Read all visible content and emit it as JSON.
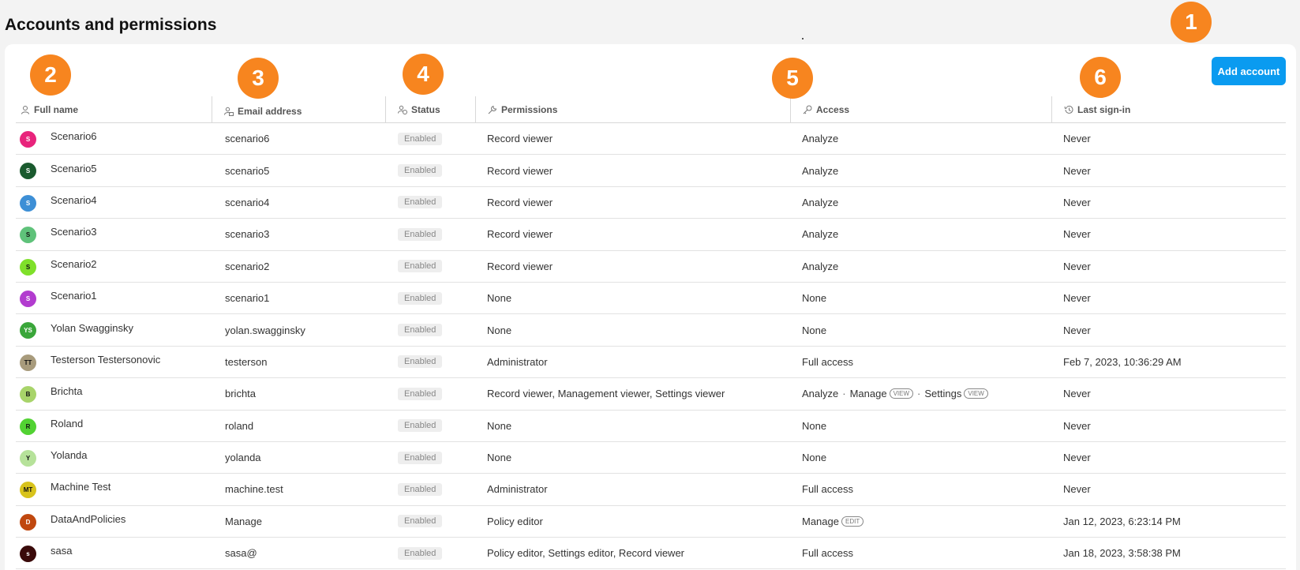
{
  "page": {
    "title": "Accounts and permissions"
  },
  "toolbar": {
    "add_label": "Add account"
  },
  "markers": [
    "1",
    "2",
    "3",
    "4",
    "5",
    "6"
  ],
  "columns": {
    "name": {
      "label": "Full name",
      "icon": "user-icon"
    },
    "email": {
      "label": "Email address",
      "icon": "user-email-icon"
    },
    "status": {
      "label": "Status",
      "icon": "user-status-icon"
    },
    "permissions": {
      "label": "Permissions",
      "icon": "wrench-icon"
    },
    "access": {
      "label": "Access",
      "icon": "key-icon"
    },
    "last": {
      "label": "Last sign-in",
      "icon": "history-icon"
    }
  },
  "colors": {
    "accent": "#0a9bf0",
    "marker": "#f7851f"
  },
  "rows": [
    {
      "initials": "S",
      "avatar_color": "#e8247c",
      "avatar_text": "#ffffff",
      "name": "Scenario6",
      "email": "scenario6",
      "status": "Enabled",
      "permissions": "Record viewer",
      "access": [
        {
          "t": "Analyze"
        }
      ],
      "last": "Never"
    },
    {
      "initials": "S",
      "avatar_color": "#1a5a2e",
      "avatar_text": "#ffffff",
      "name": "Scenario5",
      "email": "scenario5",
      "status": "Enabled",
      "permissions": "Record viewer",
      "access": [
        {
          "t": "Analyze"
        }
      ],
      "last": "Never"
    },
    {
      "initials": "S",
      "avatar_color": "#3d8fd6",
      "avatar_text": "#ffffff",
      "name": "Scenario4",
      "email": "scenario4",
      "status": "Enabled",
      "permissions": "Record viewer",
      "access": [
        {
          "t": "Analyze"
        }
      ],
      "last": "Never"
    },
    {
      "initials": "S",
      "avatar_color": "#5fc27a",
      "avatar_text": "#111111",
      "name": "Scenario3",
      "email": "scenario3",
      "status": "Enabled",
      "permissions": "Record viewer",
      "access": [
        {
          "t": "Analyze"
        }
      ],
      "last": "Never"
    },
    {
      "initials": "S",
      "avatar_color": "#7fe02a",
      "avatar_text": "#111111",
      "name": "Scenario2",
      "email": "scenario2",
      "status": "Enabled",
      "permissions": "Record viewer",
      "access": [
        {
          "t": "Analyze"
        }
      ],
      "last": "Never"
    },
    {
      "initials": "S",
      "avatar_color": "#b23ccf",
      "avatar_text": "#ffffff",
      "name": "Scenario1",
      "email": "scenario1",
      "status": "Enabled",
      "permissions": "None",
      "access": [
        {
          "t": "None"
        }
      ],
      "last": "Never"
    },
    {
      "initials": "YS",
      "avatar_color": "#3aa63a",
      "avatar_text": "#ffffff",
      "name": "Yolan Swagginsky",
      "email": "yolan.swagginsky",
      "status": "Enabled",
      "permissions": "None",
      "access": [
        {
          "t": "None"
        }
      ],
      "last": "Never"
    },
    {
      "initials": "TT",
      "avatar_color": "#a89b7c",
      "avatar_text": "#111111",
      "name": "Testerson Testersonovic",
      "email": "testerson",
      "status": "Enabled",
      "permissions": "Administrator",
      "access": [
        {
          "t": "Full access"
        }
      ],
      "last": "Feb 7, 2023, 10:36:29 AM"
    },
    {
      "initials": "B",
      "avatar_color": "#a8d46a",
      "avatar_text": "#111111",
      "name": "Brichta",
      "email": "brichta",
      "status": "Enabled",
      "permissions": "Record viewer, Management viewer, Settings viewer",
      "access": [
        {
          "t": "Analyze"
        },
        {
          "t": "Manage",
          "pill": "VIEW"
        },
        {
          "t": "Settings",
          "pill": "VIEW"
        }
      ],
      "last": "Never"
    },
    {
      "initials": "R",
      "avatar_color": "#52d233",
      "avatar_text": "#111111",
      "name": "Roland",
      "email": "roland",
      "status": "Enabled",
      "permissions": "None",
      "access": [
        {
          "t": "None"
        }
      ],
      "last": "Never"
    },
    {
      "initials": "Y",
      "avatar_color": "#b6e29a",
      "avatar_text": "#111111",
      "name": "Yolanda",
      "email": "yolanda",
      "status": "Enabled",
      "permissions": "None",
      "access": [
        {
          "t": "None"
        }
      ],
      "last": "Never"
    },
    {
      "initials": "MT",
      "avatar_color": "#d8c31c",
      "avatar_text": "#111111",
      "name": "Machine Test",
      "email": "machine.test",
      "status": "Enabled",
      "permissions": "Administrator",
      "access": [
        {
          "t": "Full access"
        }
      ],
      "last": "Never"
    },
    {
      "initials": "D",
      "avatar_color": "#c0480f",
      "avatar_text": "#ffffff",
      "name": "DataAndPolicies",
      "email": "Manage",
      "status": "Enabled",
      "permissions": "Policy editor",
      "access": [
        {
          "t": "Manage",
          "pill": "EDIT"
        }
      ],
      "last": "Jan 12, 2023, 6:23:14 PM"
    },
    {
      "initials": "s",
      "avatar_color": "#3a0a0a",
      "avatar_text": "#ffffff",
      "name": "sasa",
      "email": "sasa@",
      "status": "Enabled",
      "permissions": "Policy editor, Settings editor, Record viewer",
      "access": [
        {
          "t": "Full access"
        }
      ],
      "last": "Jan 18, 2023, 3:58:38 PM"
    }
  ]
}
